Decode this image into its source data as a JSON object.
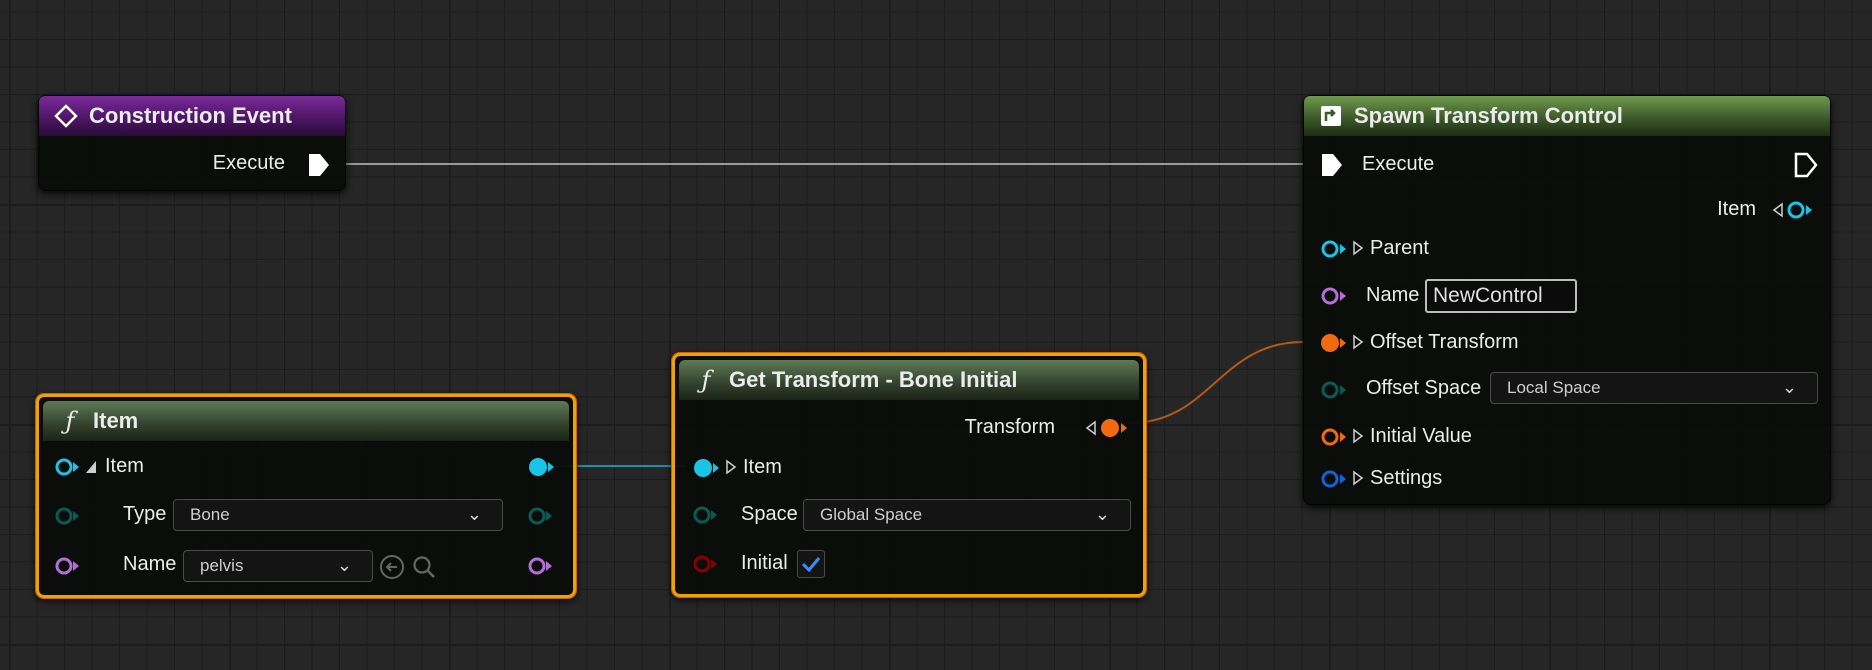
{
  "nodes": {
    "construction_event": {
      "title": "Construction Event",
      "execute_label": "Execute"
    },
    "item": {
      "title": "Item",
      "item_label": "Item",
      "type_label": "Type",
      "type_value": "Bone",
      "name_label": "Name",
      "name_value": "pelvis"
    },
    "get_transform": {
      "title": "Get Transform - Bone Initial",
      "transform_label": "Transform",
      "item_label": "Item",
      "space_label": "Space",
      "space_value": "Global Space",
      "initial_label": "Initial",
      "initial_checked": true
    },
    "spawn_transform": {
      "title": "Spawn Transform Control",
      "execute_label": "Execute",
      "item_out_label": "Item",
      "parent_label": "Parent",
      "name_label": "Name",
      "name_value": "NewControl",
      "offset_transform_label": "Offset Transform",
      "offset_space_label": "Offset Space",
      "offset_space_value": "Local Space",
      "initial_value_label": "Initial Value",
      "settings_label": "Settings"
    }
  },
  "colors": {
    "exec": "#ffffff",
    "struct_item": "#1ac4e6",
    "name": "#b36fd6",
    "transform": "#f26a0f",
    "enum": "#0b5b55",
    "bool": "#8a0000",
    "settings": "#1561d6",
    "selection": "#f2a007"
  }
}
